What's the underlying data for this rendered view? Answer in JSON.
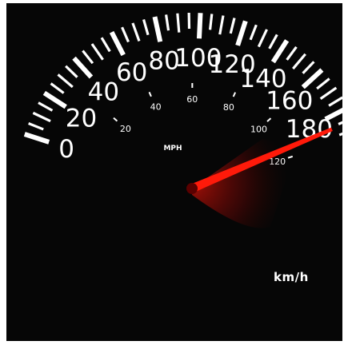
{
  "gauge": {
    "unit_label": "km/h",
    "inner_unit_label": "MPH",
    "kmh_labels": [
      "0",
      "20",
      "40",
      "60",
      "80",
      "100",
      "120",
      "140",
      "160",
      "180"
    ],
    "mph_labels": [
      "20",
      "40",
      "60",
      "80",
      "100",
      "120"
    ],
    "needle_reading_kmh": 186,
    "colors": {
      "background": "#060606",
      "ticks": "#ffffff",
      "needle": "#ff1a0a",
      "blur": "#b0100a"
    }
  }
}
